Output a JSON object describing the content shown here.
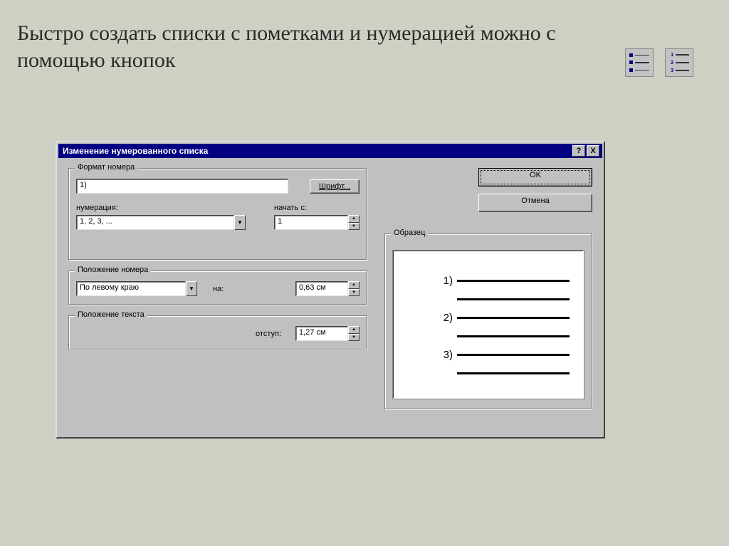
{
  "slide": {
    "title": "Быстро создать списки с пометками и нумерацией можно с помощью кнопок"
  },
  "dialog": {
    "title": "Изменение нумерованного списка",
    "caption_buttons": {
      "help": "?",
      "close": "X"
    },
    "format_group": {
      "legend": "Формат номера",
      "value": "1)",
      "font_button": "Шрифт...",
      "numeration_label": "нумерация:",
      "numeration_value": "1, 2, 3, ...",
      "start_label": "начать с:",
      "start_value": "1"
    },
    "number_position_group": {
      "legend": "Положение номера",
      "align_value": "По левому краю",
      "at_label": "на:",
      "at_value": "0,63 см"
    },
    "text_position_group": {
      "legend": "Положение текста",
      "indent_label": "отступ:",
      "indent_value": "1,27 см"
    },
    "ok_button": "OK",
    "cancel_button": "Отмена",
    "preview": {
      "legend": "Образец",
      "items": [
        "1)",
        "2)",
        "3)"
      ]
    }
  }
}
